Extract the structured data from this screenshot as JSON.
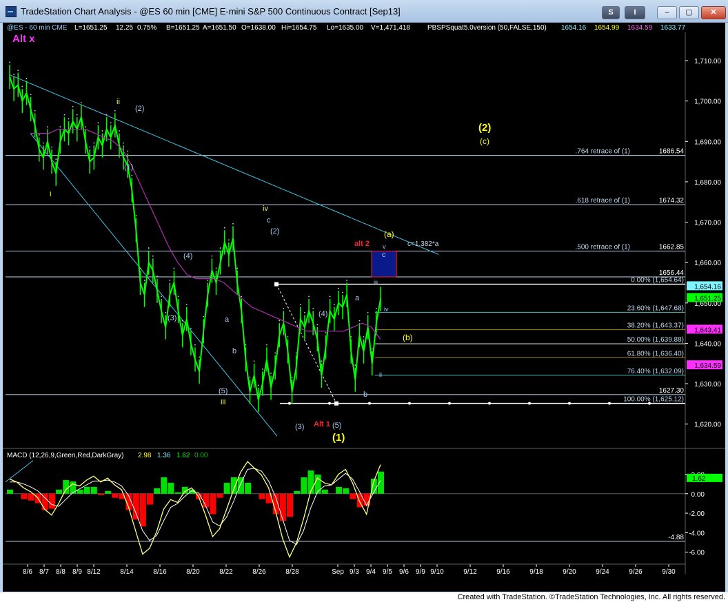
{
  "window": {
    "title": "TradeStation Chart Analysis - @ES 60 min [CME] E-mini S&P 500 Continuous Contract [Sep13]",
    "toolbar": {
      "s_button": "S",
      "i_button": "I",
      "minimize": "–",
      "restore": "▢",
      "close": "✕"
    },
    "footer": "Created with TradeStation. ©TradeStation Technologies, Inc. All rights reserved."
  },
  "colors": {
    "background": "#000000",
    "bars": "#00ff00",
    "ma": "#b030b0",
    "trendline": "#40c8e8",
    "hline": "#c0d8f0",
    "yellow": "#ffff00",
    "red": "#ff2020",
    "label_blue": "#a8c8f0",
    "fib_line": "#5fbfbf",
    "fib_gold": "#a08000",
    "macd_up": "#00e000",
    "macd_down": "#ff0000",
    "macd_line": "#ffff80",
    "grid_text": "#ffffff"
  },
  "status": {
    "symbol": "@ES - 60 min CME",
    "last": "L=1651.25",
    "chg": "12.25",
    "pct": "0.75%",
    "bid": "B=1651.25",
    "ask": "A=1651.50",
    "open": "O=1638.00",
    "hi": "Hi=1654.75",
    "lo": "Lo=1635.00",
    "vol": "V=1,471,418",
    "study": "PBSPSquat5.0version (50,FALSE,150)",
    "study_values": [
      "1654.16",
      "1654.99",
      "1634.59",
      "1633.77"
    ]
  },
  "chart_data": {
    "type": "line",
    "title": "@ES 60 min [CME] E-mini S&P 500 Continuous Contract [Sep13]",
    "ylim": [
      1615,
      1717
    ],
    "y_ticks": [
      "1,620.00",
      "1,630.00",
      "1,640.00",
      "1,650.00",
      "1,660.00",
      "1,670.00",
      "1,680.00",
      "1,690.00",
      "1,700.00",
      "1,710.00"
    ],
    "x_tick_labels": [
      "8/6",
      "8/7",
      "8/8",
      "8/9",
      "8/12",
      "8/14",
      "8/16",
      "8/20",
      "8/22",
      "8/26",
      "8/28",
      "Sep",
      "9/3",
      "9/4",
      "9/5",
      "9/6",
      "9/9",
      "9/10",
      "9/12",
      "9/16",
      "9/18",
      "9/20",
      "9/24",
      "9/26",
      "9/30"
    ],
    "series": [
      {
        "values": [
          1706,
          1703,
          1704,
          1700,
          1702,
          1698,
          1694,
          1688,
          1686,
          1690,
          1685,
          1682,
          1690,
          1693,
          1692,
          1695,
          1693,
          1696,
          1690,
          1685,
          1686,
          1691,
          1689,
          1693,
          1691,
          1694,
          1689,
          1686,
          1684,
          1678,
          1668,
          1655,
          1652,
          1660,
          1658,
          1653,
          1648,
          1644,
          1652,
          1655,
          1648,
          1642,
          1646,
          1640,
          1636,
          1633,
          1643,
          1652,
          1658,
          1655,
          1660,
          1665,
          1662,
          1666,
          1655,
          1648,
          1636,
          1628,
          1632,
          1626,
          1630,
          1636,
          1629,
          1634,
          1642,
          1645,
          1638,
          1628,
          1634,
          1646,
          1644,
          1648,
          1645,
          1641,
          1632,
          1639,
          1648,
          1646,
          1650,
          1649,
          1652,
          1638,
          1631,
          1642,
          1638,
          1644,
          1635,
          1645,
          1651
        ]
      }
    ],
    "ma_series": [
      {
        "values": [
          1692,
          1692,
          1692,
          1693,
          1693,
          1693,
          1693,
          1692,
          1691,
          1690,
          1688,
          1684,
          1679,
          1674,
          1669,
          1664,
          1660,
          1657,
          1656,
          1656,
          1656,
          1655,
          1653,
          1651,
          1649,
          1648,
          1647,
          1646,
          1645,
          1644,
          1643,
          1643,
          1643,
          1643,
          1643,
          1644,
          1645,
          1644,
          1641
        ]
      }
    ],
    "horizontal_levels": [
      {
        "value": 1686.54,
        "label": ".764 retrace of (1)",
        "price": "1686.54"
      },
      {
        "value": 1674.32,
        "label": ".618 retrace of (1)",
        "price": "1674.32"
      },
      {
        "value": 1662.85,
        "label": ".500 retrace of (1)",
        "price": "1662.85"
      },
      {
        "value": 1656.44,
        "label": "",
        "price": "1656.44"
      },
      {
        "value": 1627.3,
        "label": "",
        "price": "1627.30"
      }
    ],
    "fib_levels": [
      {
        "value": 1654.64,
        "label": "0.00% (1,654.64)"
      },
      {
        "value": 1647.68,
        "label": "23.60% (1,647.68)"
      },
      {
        "value": 1643.37,
        "label": "38.20% (1,643.37)"
      },
      {
        "value": 1639.88,
        "label": "50.00% (1,639.88)"
      },
      {
        "value": 1636.4,
        "label": "61.80% (1,636.40)"
      },
      {
        "value": 1632.09,
        "label": "76.40% (1,632.09)"
      },
      {
        "value": 1625.12,
        "label": "100.00% (1,625.12)"
      }
    ],
    "price_tags": [
      {
        "value": 1654.16,
        "text": "1,654.16",
        "color": "#7ff5ff"
      },
      {
        "value": 1651.25,
        "text": "1,651.25",
        "color": "#00ff00"
      },
      {
        "value": 1643.41,
        "text": "1,643.41",
        "color": "#ff30ff"
      },
      {
        "value": 1634.59,
        "text": "1,634.59",
        "color": "#ff30ff"
      }
    ],
    "wave_labels": {
      "alt_x": "Alt x",
      "i": "i",
      "ii": "ii",
      "iii": "iii",
      "iv": "iv",
      "w1": "(1)",
      "w2": "(2)",
      "w3": "(3)",
      "w4": "(4)",
      "w5": "(5)",
      "a": "a",
      "b": "b",
      "c": "c",
      "v": "v",
      "iv_small": "iv",
      "ii_small": "ii",
      "iii_small": "iii",
      "big_1": "(1)",
      "big_2": "(2)",
      "big_c": "(c)",
      "big_a": "(a)",
      "big_b": "(b)",
      "alt1": "Alt 1",
      "alt2": "alt 2",
      "c_ratio": "c=1.382*a"
    }
  },
  "macd": {
    "label": "MACD (12,26,9,Green,Red,DarkGray)",
    "values": [
      "2.98",
      "1.36",
      "1.62",
      "0.00"
    ],
    "ylim": [
      -6.8,
      3.8
    ],
    "y_ticks": [
      "2.00",
      "0.00",
      "-2.00",
      "-4.00",
      "-6.00"
    ],
    "level_line": "-4.88",
    "current_tag": "1.62",
    "line_values": [
      1.5,
      1.2,
      0.6,
      0.2,
      -0.4,
      -1.6,
      -2.2,
      -1.0,
      0.4,
      1.0,
      0.8,
      1.4,
      1.8,
      1.2,
      1.6,
      0.9,
      0.4,
      -1.4,
      -3.8,
      -6.2,
      -5.6,
      -3.9,
      -1.6,
      -0.6,
      -0.9,
      0.2,
      0.6,
      -0.3,
      -2.2,
      -4.4,
      -3.6,
      -1.6,
      0.4,
      2.2,
      3.3,
      2.6,
      1.9,
      0.6,
      -1.8,
      -4.6,
      -6.5,
      -5.0,
      -2.6,
      0.2,
      1.6,
      1.1,
      0.9,
      2.0,
      2.5,
      1.1,
      -0.8,
      -2.1,
      1.2,
      2.98
    ],
    "signal_values": [
      1.2,
      1.2,
      1.0,
      0.7,
      0.3,
      -0.4,
      -1.1,
      -1.3,
      -0.6,
      0.1,
      0.5,
      0.9,
      1.3,
      1.3,
      1.4,
      1.2,
      0.8,
      -0.2,
      -1.9,
      -3.8,
      -4.8,
      -4.3,
      -2.8,
      -1.4,
      -1.0,
      -0.3,
      0.3,
      0.1,
      -1.2,
      -2.9,
      -3.3,
      -2.4,
      -0.8,
      1.0,
      2.5,
      2.6,
      2.3,
      1.3,
      -0.3,
      -2.6,
      -4.8,
      -5.2,
      -3.8,
      -1.5,
      0.2,
      0.8,
      0.9,
      1.5,
      2.1,
      1.5,
      0.2,
      -1.2,
      0.1,
      1.36
    ]
  }
}
